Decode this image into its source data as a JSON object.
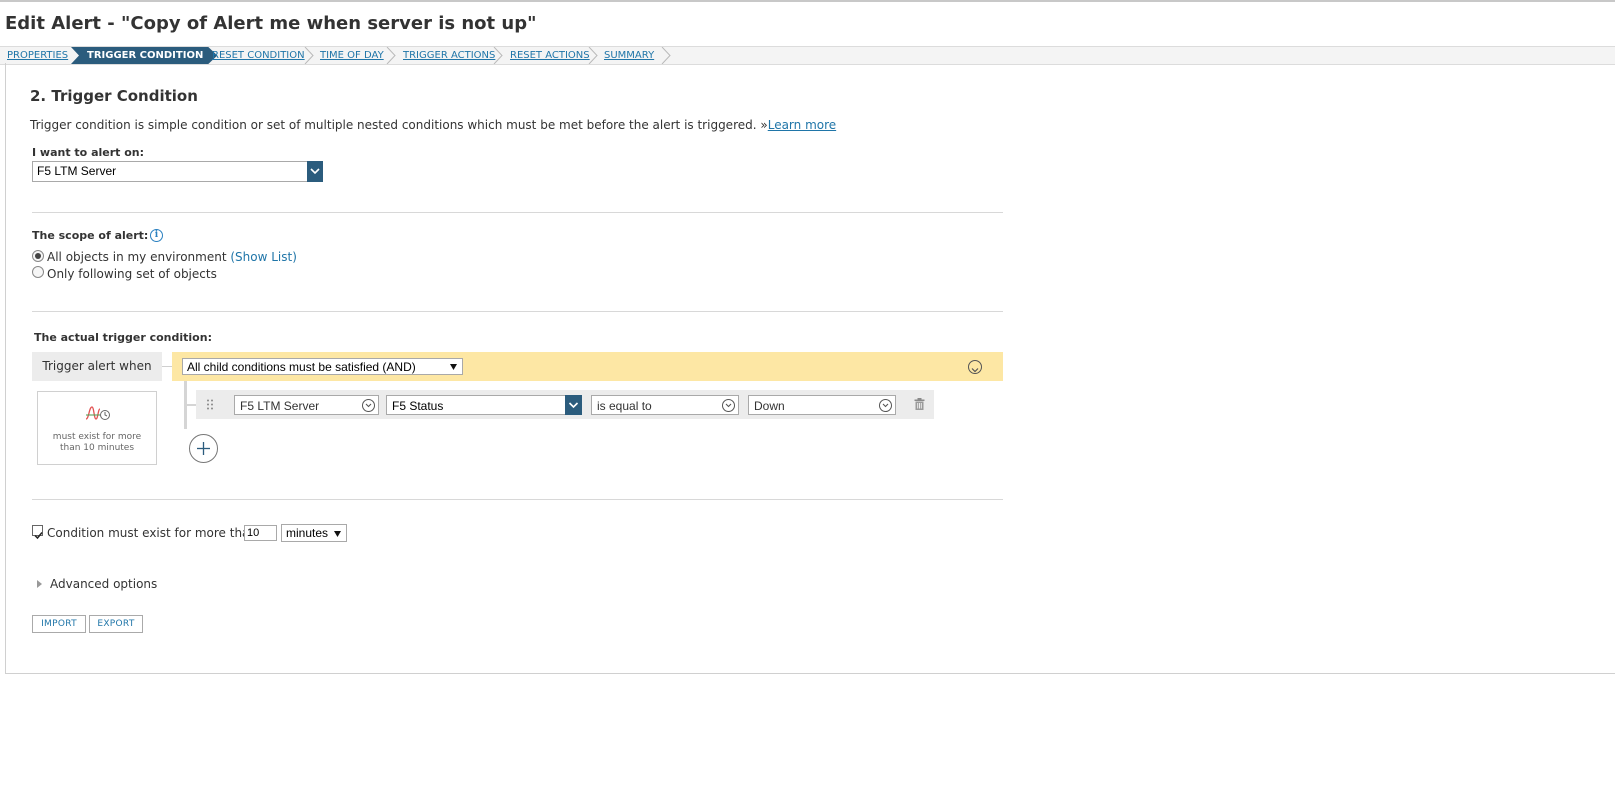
{
  "page": {
    "title": "Edit Alert - \"Copy of Alert me when server is not up\""
  },
  "wizard": {
    "steps": [
      {
        "label": "PROPERTIES",
        "active": false
      },
      {
        "label": "TRIGGER CONDITION",
        "active": true
      },
      {
        "label": "RESET CONDITION",
        "active": false
      },
      {
        "label": "TIME OF DAY",
        "active": false
      },
      {
        "label": "TRIGGER ACTIONS",
        "active": false
      },
      {
        "label": "RESET ACTIONS",
        "active": false
      },
      {
        "label": "SUMMARY",
        "active": false
      }
    ]
  },
  "section": {
    "heading": "2. Trigger Condition",
    "description": "Trigger condition is simple condition or set of multiple nested conditions which must be met before the alert is triggered. »",
    "learn_more": "Learn more"
  },
  "alert_on": {
    "label": "I want to alert on:",
    "value": "F5 LTM Server"
  },
  "scope": {
    "label": "The scope of alert:",
    "option_all": "All objects in my environment",
    "show_list": "(Show List)",
    "option_following": "Only following set of objects",
    "selected": "all"
  },
  "trigger": {
    "label": "The actual trigger condition:",
    "when_label": "Trigger alert when",
    "logic_value": "All child conditions must be satisfied (AND)",
    "condition": {
      "object": "F5 LTM Server",
      "field": "F5 Status",
      "operator": "is equal to",
      "value": "Down"
    },
    "sustain_text": "must exist for more than 10 minutes"
  },
  "sustain": {
    "checked": true,
    "label": "Condition must exist for more than",
    "amount": "10",
    "unit": "minutes"
  },
  "advanced": {
    "label": "Advanced options"
  },
  "buttons": {
    "import": "IMPORT",
    "export": "EXPORT"
  },
  "colors": {
    "accent": "#2b5c7d",
    "link": "#1f75a8",
    "and_bar": "#fde7a4"
  }
}
